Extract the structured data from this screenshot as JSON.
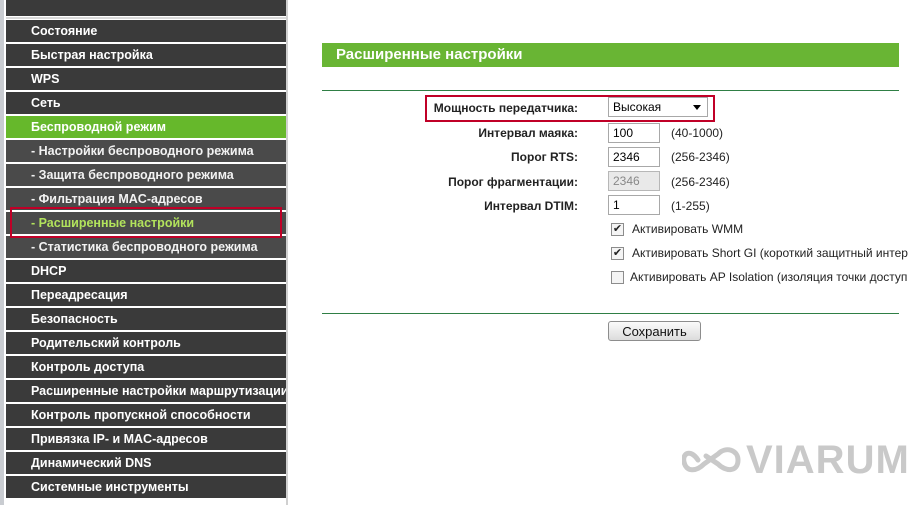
{
  "sidebar": {
    "items": [
      {
        "label": "Состояние"
      },
      {
        "label": "Быстрая настройка"
      },
      {
        "label": "WPS"
      },
      {
        "label": "Сеть"
      },
      {
        "label": "Беспроводной режим"
      },
      {
        "label": "- Настройки беспроводного режима"
      },
      {
        "label": "- Защита беспроводного режима"
      },
      {
        "label": "- Фильтрация MAC-адресов"
      },
      {
        "label": "- Расширенные настройки"
      },
      {
        "label": "- Статистика беспроводного режима"
      },
      {
        "label": "DHCP"
      },
      {
        "label": "Переадресация"
      },
      {
        "label": "Безопасность"
      },
      {
        "label": "Родительский контроль"
      },
      {
        "label": "Контроль доступа"
      },
      {
        "label": "Расширенные настройки маршрутизации"
      },
      {
        "label": "Контроль пропускной способности"
      },
      {
        "label": "Привязка IP- и MAC-адресов"
      },
      {
        "label": "Динамический DNS"
      },
      {
        "label": "Системные инструменты"
      }
    ]
  },
  "main": {
    "title": "Расширенные настройки",
    "tx_power": {
      "label": "Мощность передатчика:",
      "value": "Высокая"
    },
    "beacon": {
      "label": "Интервал маяка:",
      "value": "100",
      "hint": "(40-1000)"
    },
    "rts": {
      "label": "Порог RTS:",
      "value": "2346",
      "hint": "(256-2346)"
    },
    "frag": {
      "label": "Порог фрагментации:",
      "value": "2346",
      "hint": "(256-2346)"
    },
    "dtim": {
      "label": "Интервал DTIM:",
      "value": "1",
      "hint": "(1-255)"
    },
    "wmm": {
      "label": "Активировать WMM",
      "checked": true
    },
    "short_gi": {
      "label": "Активировать Short GI (короткий защитный интер",
      "checked": true
    },
    "ap_isolation": {
      "label": "Активировать AP Isolation (изоляция точки доступ",
      "checked": false
    },
    "save_label": "Сохранить"
  },
  "watermark": {
    "text": "VIARUM"
  },
  "colors": {
    "accent": "#66b82b",
    "highlight": "#c00027",
    "nav": "#3a3a3a"
  }
}
